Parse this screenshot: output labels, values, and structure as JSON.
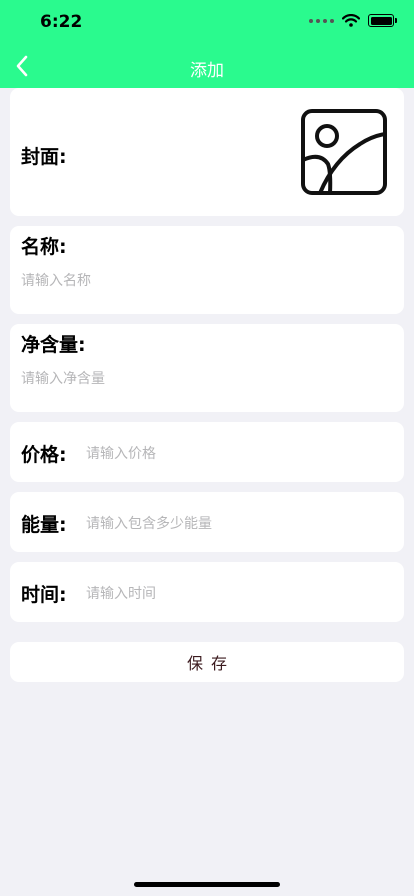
{
  "status_bar": {
    "time": "6:22"
  },
  "header": {
    "title": "添加"
  },
  "form": {
    "cover": {
      "label": "封面:"
    },
    "name": {
      "label": "名称:",
      "placeholder": "请输入名称"
    },
    "net_content": {
      "label": "净含量:",
      "placeholder": "请输入净含量"
    },
    "price": {
      "label": "价格:",
      "placeholder": "请输入价格"
    },
    "energy": {
      "label": "能量:",
      "placeholder": "请输入包含多少能量"
    },
    "time": {
      "label": "时间:",
      "placeholder": "请输入时间"
    }
  },
  "save_label": "保存",
  "colors": {
    "header_bg": "#2afa8e",
    "page_bg": "#f1f1f6",
    "save_text": "#3b1a1e"
  }
}
